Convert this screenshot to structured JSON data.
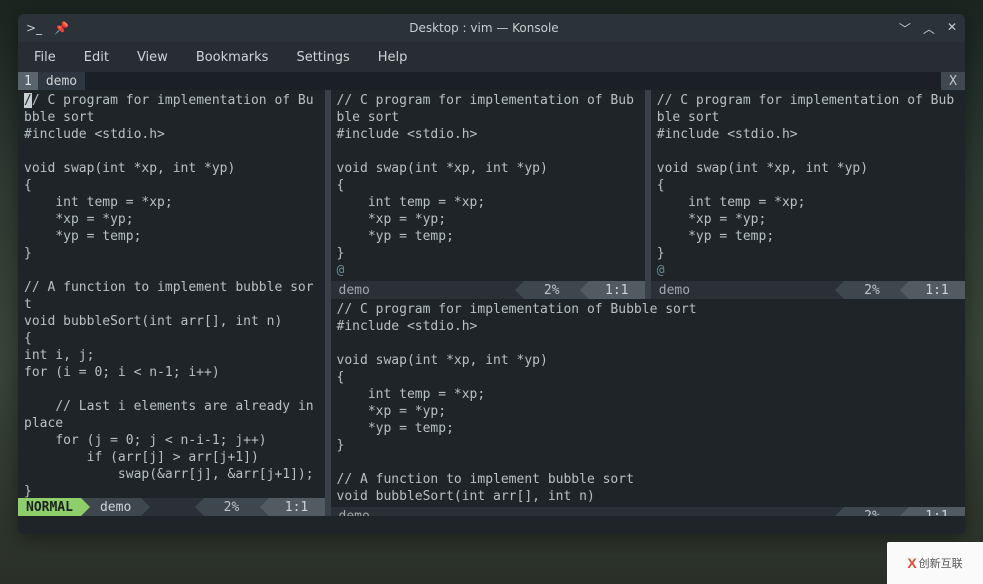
{
  "window": {
    "title": "Desktop : vim — Konsole"
  },
  "menubar": [
    "File",
    "Edit",
    "View",
    "Bookmarks",
    "Settings",
    "Help"
  ],
  "tab": {
    "index": "1",
    "name": "demo",
    "close": "X"
  },
  "code_long": "// C program for implementation of Bubble sort\n#include <stdio.h>\n\nvoid swap(int *xp, int *yp)\n{\n    int temp = *xp;\n    *xp = *yp;\n    *yp = temp;\n}\n\n// A function to implement bubble sort\nvoid bubbleSort(int arr[], int n)\n{\nint i, j;\nfor (i = 0; i < n-1; i++)\n\n    // Last i elements are already in place\n    for (j = 0; j < n-i-1; j++)\n        if (arr[j] > arr[j+1])\n            swap(&arr[j], &arr[j+1]);\n}",
  "code_short": "// C program for implementation of Bubble sort\n#include <stdio.h>\n\nvoid swap(int *xp, int *yp)\n{\n    int temp = *xp;\n    *xp = *yp;\n    *yp = temp;\n}\n",
  "code_mid": "// C program for implementation of Bubble sort\n#include <stdio.h>\n\nvoid swap(int *xp, int *yp)\n{\n    int temp = *xp;\n    *xp = *yp;\n    *yp = temp;\n}\n\n// A function to implement bubble sort\nvoid bubbleSort(int arr[], int n)",
  "at": "@",
  "status_active": {
    "mode": "NORMAL",
    "file": "demo",
    "pct": "2%",
    "pos": "1:1"
  },
  "status_inactive": {
    "file": "demo",
    "pct": "2%",
    "pos": "1:1"
  },
  "watermark": "创新互联"
}
